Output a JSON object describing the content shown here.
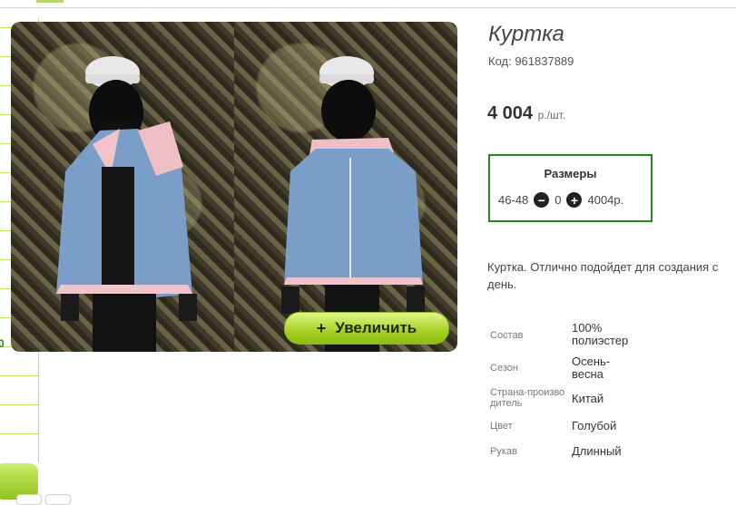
{
  "product": {
    "title": "Куртка",
    "code": "Код: 961837889",
    "price": "4 004",
    "price_unit": "р./шт.",
    "zoom_label": "Увеличить",
    "description": "Куртка. Отлично подойдет для создания с день."
  },
  "sizes": {
    "title": "Размеры",
    "size": "46-48",
    "quantity": "0",
    "price": "4004р."
  },
  "attributes": [
    {
      "key": "Состав",
      "value": "100% полиэстер"
    },
    {
      "key": "Сезон",
      "value": "Осень-весна"
    },
    {
      "key": "Страна-производитель",
      "value": "Китай"
    },
    {
      "key": "Цвет",
      "value": "Голубой"
    },
    {
      "key": "Рукав",
      "value": "Длинный"
    }
  ],
  "sidebar": {
    "fragment_label": "0"
  },
  "colors": {
    "accent_green": "#1f8a1f",
    "button_green": "#a6d024"
  },
  "icons": {
    "zoom": "plus-icon",
    "decrease": "minus-circle-icon",
    "increase": "plus-circle-icon"
  }
}
